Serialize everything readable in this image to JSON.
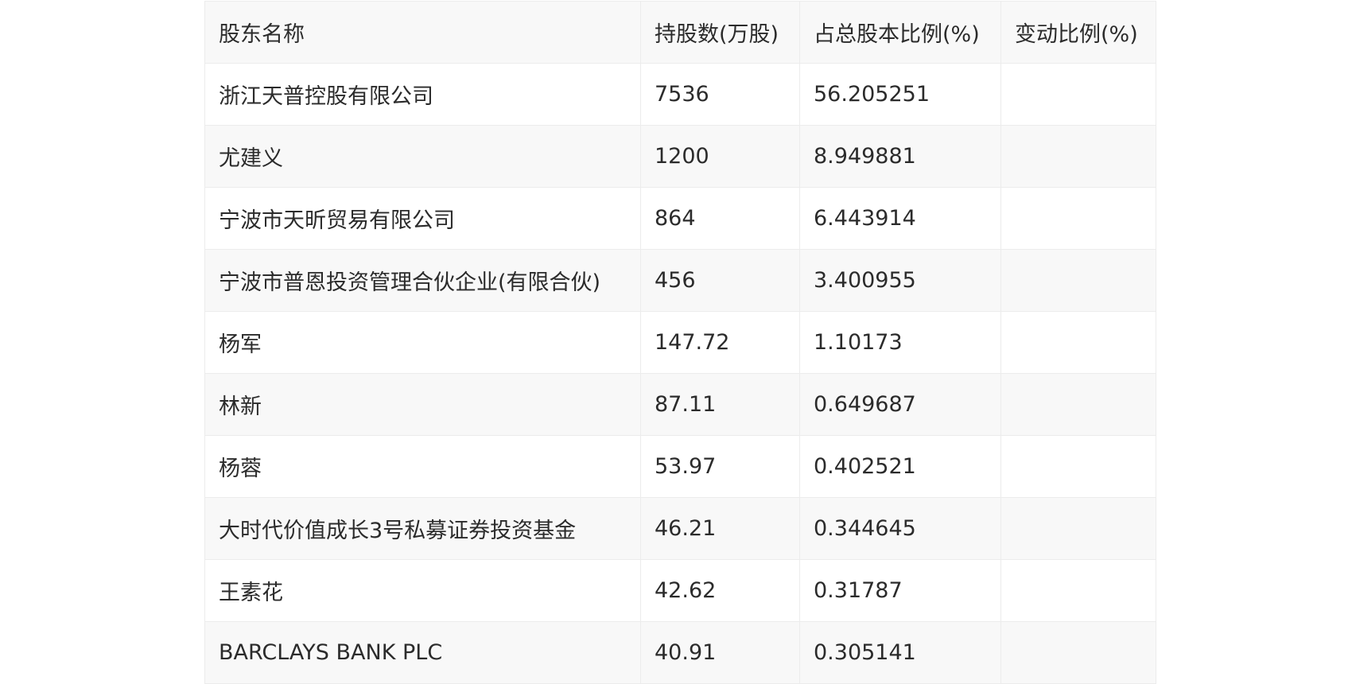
{
  "table": {
    "headers": [
      "股东名称",
      "持股数(万股)",
      "占总股本比例(%)",
      "变动比例(%)"
    ],
    "rows": [
      {
        "name": "浙江天普控股有限公司",
        "shares": "7536",
        "ratio": "56.205251",
        "change": ""
      },
      {
        "name": "尤建义",
        "shares": "1200",
        "ratio": "8.949881",
        "change": ""
      },
      {
        "name": "宁波市天昕贸易有限公司",
        "shares": "864",
        "ratio": "6.443914",
        "change": ""
      },
      {
        "name": "宁波市普恩投资管理合伙企业(有限合伙)",
        "shares": "456",
        "ratio": "3.400955",
        "change": ""
      },
      {
        "name": "杨军",
        "shares": "147.72",
        "ratio": "1.10173",
        "change": ""
      },
      {
        "name": "林新",
        "shares": "87.11",
        "ratio": "0.649687",
        "change": ""
      },
      {
        "name": "杨蓉",
        "shares": "53.97",
        "ratio": "0.402521",
        "change": ""
      },
      {
        "name": "大时代价值成长3号私募证券投资基金",
        "shares": "46.21",
        "ratio": "0.344645",
        "change": ""
      },
      {
        "name": "王素花",
        "shares": "42.62",
        "ratio": "0.31787",
        "change": ""
      },
      {
        "name": "BARCLAYS BANK PLC",
        "shares": "40.91",
        "ratio": "0.305141",
        "change": ""
      }
    ]
  }
}
